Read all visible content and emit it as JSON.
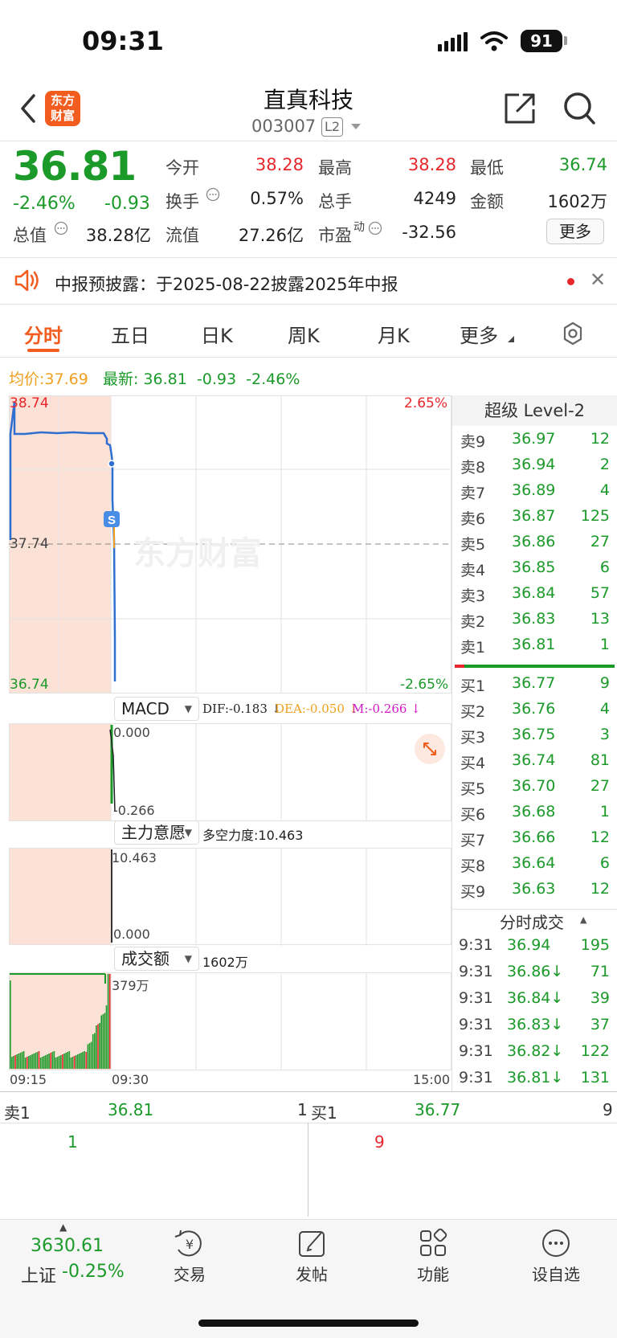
{
  "status_bar": {
    "time": "09:31",
    "battery": "91"
  },
  "header": {
    "logo_line1": "东方",
    "logo_line2": "财富",
    "stock_name": "直真科技",
    "stock_code": "003007",
    "level_badge": "L2"
  },
  "quote": {
    "price": "36.81",
    "change_pct": "-2.46%",
    "change": "-0.93",
    "fields": {
      "open_label": "今开",
      "open": "38.28",
      "high_label": "最高",
      "high": "38.28",
      "low_label": "最低",
      "low": "36.74",
      "turnover_label": "换手",
      "turnover": "0.57%",
      "volume_label": "总手",
      "volume": "4249",
      "amount_label": "金额",
      "amount": "1602万",
      "mktcap_label": "总值",
      "mktcap": "38.28亿",
      "float_label": "流值",
      "float": "27.26亿",
      "pe_label": "市盈",
      "pe_sup": "动",
      "pe": "-32.56"
    },
    "more_label": "更多"
  },
  "notice": {
    "text": "中报预披露：于2025-08-22披露2025年中报"
  },
  "tabs": [
    "分时",
    "五日",
    "日K",
    "周K",
    "月K",
    "更多"
  ],
  "intraday": {
    "avg_label": "均价:",
    "avg": "37.69",
    "latest_label": "最新:",
    "latest": "36.81",
    "latest_change": "-0.93",
    "latest_pct": "-2.46%",
    "y_max": "38.74",
    "y_mid": "37.74",
    "y_min": "36.74",
    "pct_max": "2.65%",
    "pct_min": "-2.65%",
    "watermark": "东方财富",
    "trade_marker": "S",
    "time_start": "09:15",
    "time_open": "09:30",
    "time_end": "15:00"
  },
  "macd": {
    "label": "MACD",
    "dif": "DIF:-0.183 ↓",
    "dea": "DEA:-0.050 ↓",
    "m": "M:-0.266 ↓",
    "top": "0.000",
    "bottom": "-0.266"
  },
  "main_force": {
    "label": "主力意愿",
    "text": "多空力度:10.463",
    "top": "10.463",
    "bottom": "0.000"
  },
  "turnover_chart": {
    "label": "成交额",
    "text": "1602万",
    "top": "379万"
  },
  "order_book": {
    "title": "超级 Level-2",
    "asks": [
      {
        "label": "卖9",
        "price": "36.97",
        "vol": "12"
      },
      {
        "label": "卖8",
        "price": "36.94",
        "vol": "2"
      },
      {
        "label": "卖7",
        "price": "36.89",
        "vol": "4"
      },
      {
        "label": "卖6",
        "price": "36.87",
        "vol": "125"
      },
      {
        "label": "卖5",
        "price": "36.86",
        "vol": "27"
      },
      {
        "label": "卖4",
        "price": "36.85",
        "vol": "6"
      },
      {
        "label": "卖3",
        "price": "36.84",
        "vol": "57"
      },
      {
        "label": "卖2",
        "price": "36.83",
        "vol": "13"
      },
      {
        "label": "卖1",
        "price": "36.81",
        "vol": "1"
      }
    ],
    "bids": [
      {
        "label": "买1",
        "price": "36.77",
        "vol": "9"
      },
      {
        "label": "买2",
        "price": "36.76",
        "vol": "4"
      },
      {
        "label": "买3",
        "price": "36.75",
        "vol": "3"
      },
      {
        "label": "买4",
        "price": "36.74",
        "vol": "81"
      },
      {
        "label": "买5",
        "price": "36.70",
        "vol": "27"
      },
      {
        "label": "买6",
        "price": "36.68",
        "vol": "1"
      },
      {
        "label": "买7",
        "price": "36.66",
        "vol": "12"
      },
      {
        "label": "买8",
        "price": "36.64",
        "vol": "6"
      },
      {
        "label": "买9",
        "price": "36.63",
        "vol": "12"
      }
    ]
  },
  "trade_details": {
    "title": "分时成交",
    "rows": [
      {
        "time": "9:31",
        "price": "36.94",
        "vol": "195"
      },
      {
        "time": "9:31",
        "price": "36.86↓",
        "vol": "71"
      },
      {
        "time": "9:31",
        "price": "36.84↓",
        "vol": "39"
      },
      {
        "time": "9:31",
        "price": "36.83↓",
        "vol": "37"
      },
      {
        "time": "9:31",
        "price": "36.82↓",
        "vol": "122"
      },
      {
        "time": "9:31",
        "price": "36.81↓",
        "vol": "131"
      }
    ]
  },
  "bottom_quote": {
    "ask_label": "卖1",
    "ask_price": "36.81",
    "ask_vol": "1",
    "bid_label": "买1",
    "bid_price": "36.77",
    "bid_vol": "9",
    "ask_queue": "1",
    "bid_queue": "9"
  },
  "bottom_nav": {
    "index_value": "3630.61",
    "index_name": "上证",
    "index_change": "-0.25%",
    "items": [
      "交易",
      "发帖",
      "功能",
      "设自选"
    ]
  }
}
